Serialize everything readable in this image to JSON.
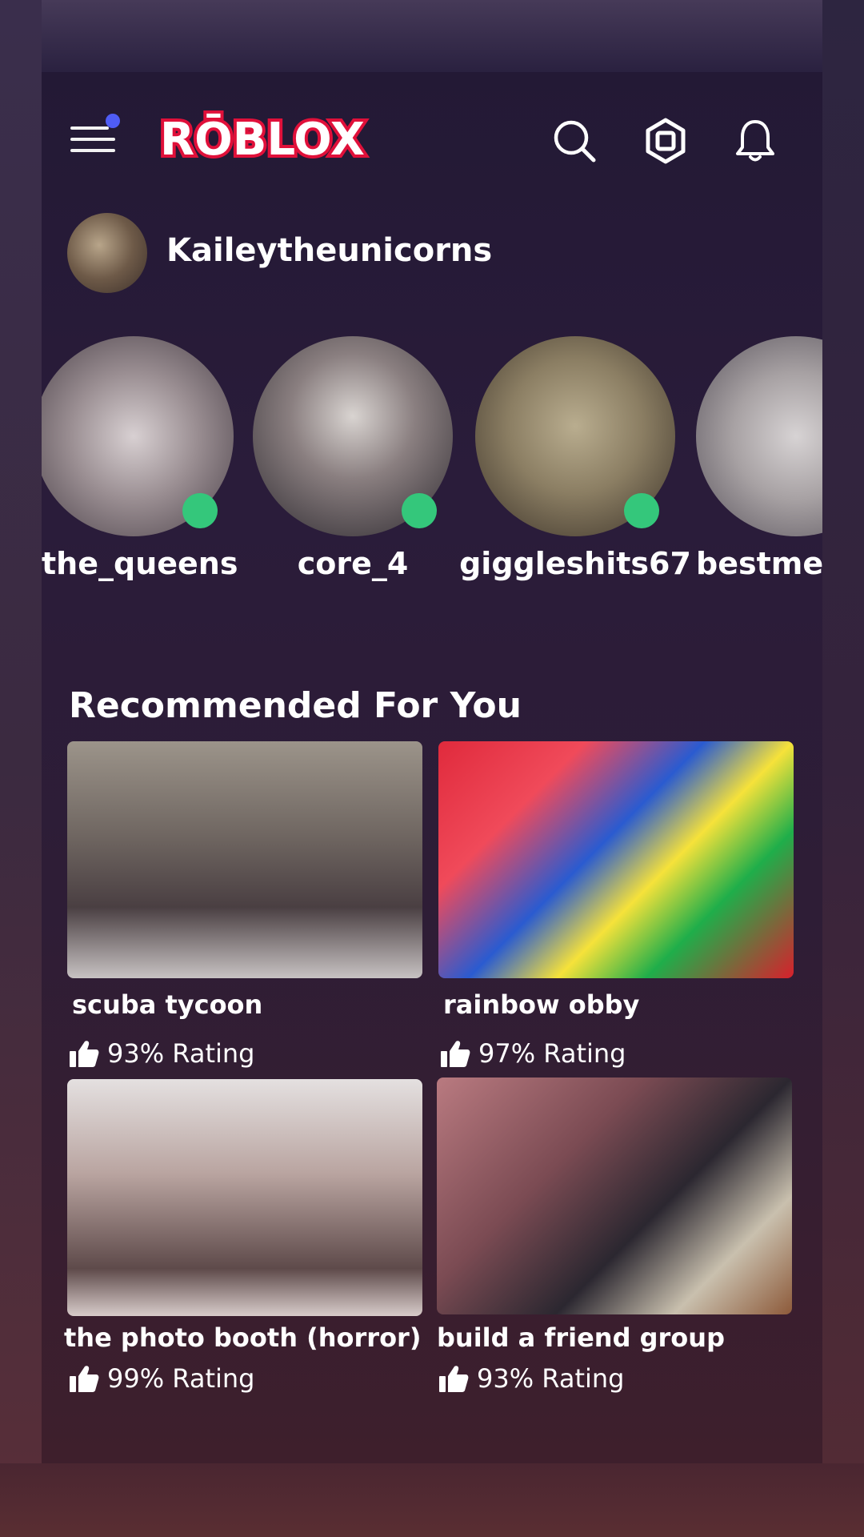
{
  "header": {
    "logo_text": "RŌBLOX",
    "menu_icon": "hamburger-menu-icon",
    "search_icon": "search-icon",
    "robux_icon": "robux-icon",
    "bell_icon": "bell-icon"
  },
  "profile": {
    "username": "Kaileytheunicorns"
  },
  "friends": [
    {
      "name": "the_queens",
      "online": true
    },
    {
      "name": "core_4",
      "online": true
    },
    {
      "name": "giggleshits67",
      "online": true
    },
    {
      "name": "bestme",
      "online": false
    }
  ],
  "recommended": {
    "title": "Recommended For You",
    "games": [
      {
        "name": "scuba tycoon",
        "rating": "93% Rating"
      },
      {
        "name": "rainbow obby",
        "rating": "97% Rating"
      },
      {
        "name": "the photo booth (horror)",
        "rating": "99% Rating"
      },
      {
        "name": "build a friend group",
        "rating": "93% Rating"
      }
    ]
  },
  "colors": {
    "accent_dot": "#4f5cf5",
    "online": "#34c77b",
    "logo_red": "#e0103a"
  }
}
